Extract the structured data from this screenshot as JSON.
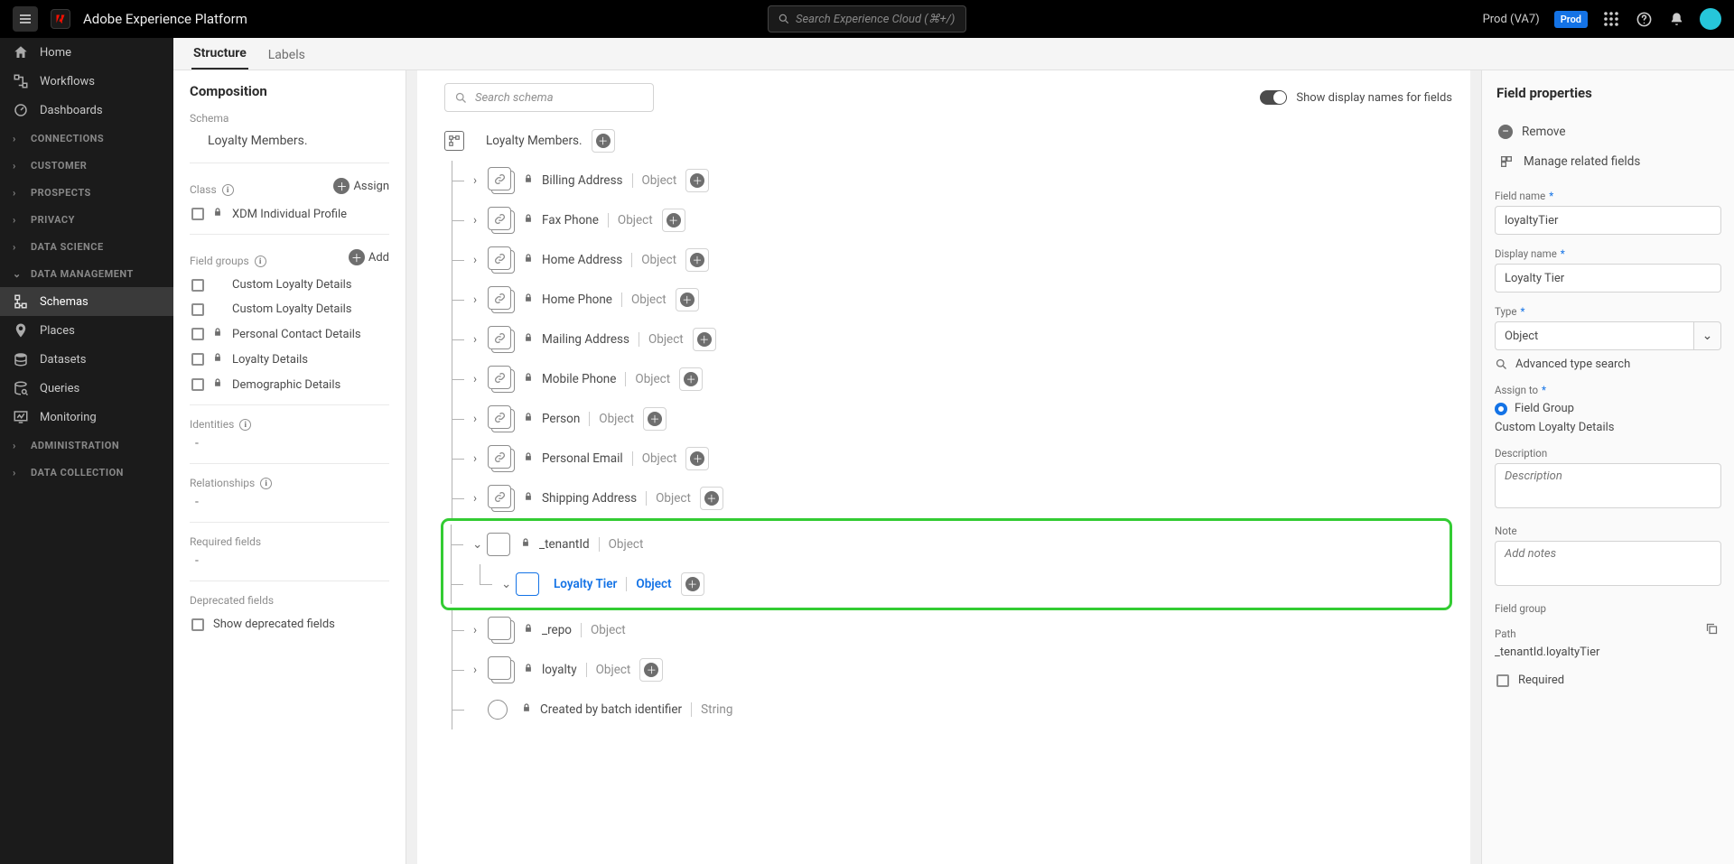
{
  "topbar": {
    "app_name": "Adobe Experience Platform",
    "search_placeholder": "Search Experience Cloud (⌘+/)",
    "env_label": "Prod (VA7)",
    "env_badge": "Prod"
  },
  "leftnav": {
    "items_top": [
      {
        "label": "Home",
        "icon": "home-icon"
      },
      {
        "label": "Workflows",
        "icon": "workflows-icon"
      },
      {
        "label": "Dashboards",
        "icon": "dashboards-icon"
      }
    ],
    "groups": [
      {
        "label": "CONNECTIONS"
      },
      {
        "label": "CUSTOMER"
      },
      {
        "label": "PROSPECTS"
      },
      {
        "label": "PRIVACY"
      },
      {
        "label": "DATA SCIENCE"
      }
    ],
    "dm_label": "DATA MANAGEMENT",
    "dm_items": [
      {
        "label": "Schemas",
        "icon": "schemas-icon",
        "active": true
      },
      {
        "label": "Places",
        "icon": "places-icon"
      },
      {
        "label": "Datasets",
        "icon": "datasets-icon"
      },
      {
        "label": "Queries",
        "icon": "queries-icon"
      },
      {
        "label": "Monitoring",
        "icon": "monitoring-icon"
      }
    ],
    "groups_after": [
      {
        "label": "ADMINISTRATION"
      },
      {
        "label": "DATA COLLECTION"
      }
    ]
  },
  "tabs": {
    "structure": "Structure",
    "labels": "Labels"
  },
  "compo": {
    "title": "Composition",
    "schema_label": "Schema",
    "schema_name": "Loyalty Members.",
    "class_label": "Class",
    "assign_label": "Assign",
    "class_name": "XDM Individual Profile",
    "fg_label": "Field groups",
    "add_label": "Add",
    "field_groups": [
      {
        "label": "Custom Loyalty Details",
        "locked": false
      },
      {
        "label": "Custom Loyalty Details",
        "locked": false
      },
      {
        "label": "Personal Contact Details",
        "locked": true
      },
      {
        "label": "Loyalty Details",
        "locked": true
      },
      {
        "label": "Demographic Details",
        "locked": true
      }
    ],
    "identities_label": "Identities",
    "relationships_label": "Relationships",
    "required_label": "Required fields",
    "deprecated_label": "Deprecated fields",
    "show_deprecated": "Show deprecated fields",
    "dash": "-"
  },
  "canvas": {
    "search_placeholder": "Search schema",
    "display_names_label": "Show display names for fields",
    "root_name": "Loyalty Members.",
    "fields": [
      {
        "name": "Billing Address",
        "type": "Object"
      },
      {
        "name": "Fax Phone",
        "type": "Object"
      },
      {
        "name": "Home Address",
        "type": "Object"
      },
      {
        "name": "Home Phone",
        "type": "Object"
      },
      {
        "name": "Mailing Address",
        "type": "Object"
      },
      {
        "name": "Mobile Phone",
        "type": "Object"
      },
      {
        "name": "Person",
        "type": "Object"
      },
      {
        "name": "Personal Email",
        "type": "Object"
      },
      {
        "name": "Shipping Address",
        "type": "Object"
      }
    ],
    "tenant_name": "_tenantId",
    "tenant_type": "Object",
    "loyalty_tier_name": "Loyalty Tier",
    "loyalty_tier_type": "Object",
    "repo_name": "_repo",
    "repo_type": "Object",
    "loyalty_name": "loyalty",
    "loyalty_type": "Object",
    "created_name": "Created by batch identifier",
    "created_type": "String"
  },
  "props": {
    "title": "Field properties",
    "remove": "Remove",
    "manage_related": "Manage related fields",
    "field_name_label": "Field name",
    "field_name_value": "loyaltyTier",
    "display_name_label": "Display name",
    "display_name_value": "Loyalty Tier",
    "type_label": "Type",
    "type_value": "Object",
    "adv_search": "Advanced type search",
    "assign_label": "Assign to",
    "fg_radio": "Field Group",
    "fg_value": "Custom Loyalty Details",
    "desc_label": "Description",
    "desc_placeholder": "Description",
    "note_label": "Note",
    "note_placeholder": "Add notes",
    "fg_section": "Field group",
    "path_label": "Path",
    "path_value": "_tenantId.loyaltyTier",
    "required_label": "Required"
  }
}
